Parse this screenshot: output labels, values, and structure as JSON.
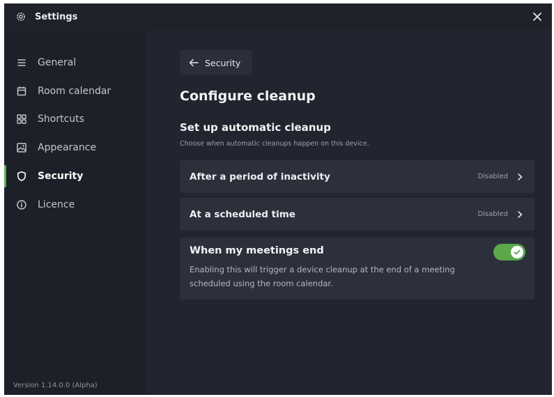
{
  "window": {
    "title": "Settings",
    "icon": "gear-icon",
    "close_icon": "close-icon"
  },
  "sidebar": {
    "items": [
      {
        "label": "General",
        "icon": "list-icon"
      },
      {
        "label": "Room calendar",
        "icon": "calendar-icon"
      },
      {
        "label": "Shortcuts",
        "icon": "grid-icon"
      },
      {
        "label": "Appearance",
        "icon": "image-icon"
      },
      {
        "label": "Security",
        "icon": "shield-icon",
        "active": true
      },
      {
        "label": "Licence",
        "icon": "info-icon"
      }
    ],
    "version": "Version 1.14.0.0 (Alpha)"
  },
  "main": {
    "back_label": "Security",
    "page_title": "Configure cleanup",
    "section_title": "Set up automatic cleanup",
    "section_subtitle": "Choose when automatic cleanups happen on this device.",
    "rows": [
      {
        "label": "After a period of inactivity",
        "status": "Disabled"
      },
      {
        "label": "At a scheduled time",
        "status": "Disabled"
      }
    ],
    "meetings": {
      "title": "When my meetings end",
      "description": "Enabling this will trigger a device cleanup at the end of a meeting scheduled using the room calendar.",
      "toggle_on": true
    }
  },
  "colors": {
    "accent": "#5aa84a",
    "window_bg": "#22252f",
    "sidebar_bg": "#1d2028",
    "row_bg": "#2c303b"
  }
}
